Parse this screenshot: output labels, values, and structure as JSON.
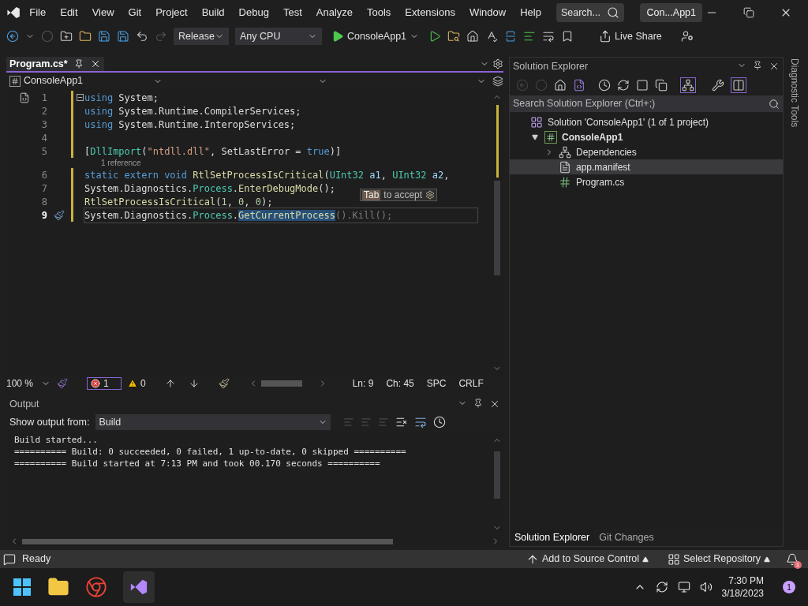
{
  "title_bar": {
    "menu": [
      "File",
      "Edit",
      "View",
      "Git",
      "Project",
      "Build",
      "Debug",
      "Test",
      "Analyze",
      "Tools",
      "Extensions",
      "Window",
      "Help"
    ],
    "search": {
      "placeholder": "Search..."
    },
    "solution_name": "Con...App1"
  },
  "toolbar": {
    "configuration": "Release",
    "platform": "Any CPU",
    "start": "ConsoleApp1",
    "live_share": "Live Share"
  },
  "editor": {
    "tabs": [
      {
        "label": "Program.cs*",
        "selected": true
      }
    ],
    "nav": {
      "project": "ConsoleApp1"
    },
    "lines": [
      {
        "number": "1",
        "current": false,
        "fold": true,
        "tokens": [
          {
            "kind": "kw",
            "text": "using"
          },
          {
            "kind": "plain",
            "text": " System;"
          }
        ]
      },
      {
        "number": "2",
        "current": false,
        "fold": false,
        "tokens": [
          {
            "kind": "kw",
            "text": "using"
          },
          {
            "kind": "plain",
            "text": " System.Runtime.CompilerServices;"
          }
        ]
      },
      {
        "number": "3",
        "current": false,
        "fold": false,
        "tokens": [
          {
            "kind": "kw",
            "text": "using"
          },
          {
            "kind": "plain",
            "text": " System.Runtime.InteropServices;"
          }
        ]
      },
      {
        "number": "4",
        "current": false,
        "fold": false
      },
      {
        "number": "5",
        "current": false,
        "fold": false,
        "tokens": [
          {
            "kind": "plain",
            "text": "["
          },
          {
            "kind": "type",
            "text": "DllImport"
          },
          {
            "kind": "plain",
            "text": "("
          },
          {
            "kind": "str",
            "text": "\"ntdll.dll\""
          },
          {
            "kind": "plain",
            "text": ", SetLastError = "
          },
          {
            "kind": "kw",
            "text": "true"
          },
          {
            "kind": "plain",
            "text": ")]"
          }
        ]
      },
      {
        "number": "6",
        "current": false,
        "fold": false,
        "codelens": "1 reference",
        "tokens": [
          {
            "kind": "kw",
            "text": "static extern void"
          },
          {
            "kind": "method",
            "text": " RtlSetProcessIsCritical"
          },
          {
            "kind": "plain",
            "text": "("
          },
          {
            "kind": "type",
            "text": "UInt32"
          },
          {
            "kind": "param",
            "text": " a1"
          },
          {
            "kind": "plain",
            "text": ", "
          },
          {
            "kind": "type",
            "text": "UInt32"
          },
          {
            "kind": "param",
            "text": " a2"
          },
          {
            "kind": "plain",
            "text": ","
          }
        ]
      },
      {
        "number": "7",
        "current": false,
        "fold": false,
        "tokens": [
          {
            "kind": "plain",
            "text": "System.Diagnostics."
          },
          {
            "kind": "type",
            "text": "Process"
          },
          {
            "kind": "plain",
            "text": "."
          },
          {
            "kind": "method",
            "text": "EnterDebugMode"
          },
          {
            "kind": "plain",
            "text": "();"
          }
        ]
      },
      {
        "number": "8",
        "current": false,
        "fold": false,
        "tokens": [
          {
            "kind": "method",
            "text": "RtlSetProcessIsCritical"
          },
          {
            "kind": "plain",
            "text": "("
          },
          {
            "kind": "num",
            "text": "1"
          },
          {
            "kind": "plain",
            "text": ", "
          },
          {
            "kind": "num",
            "text": "0"
          },
          {
            "kind": "plain",
            "text": ", "
          },
          {
            "kind": "num",
            "text": "0"
          },
          {
            "kind": "plain",
            "text": ");"
          }
        ]
      },
      {
        "number": "9",
        "current": true,
        "fold": false,
        "tokens": [
          {
            "kind": "plain",
            "text": "System.Diagnostics."
          },
          {
            "kind": "type",
            "text": "Process"
          },
          {
            "kind": "plain",
            "text": "."
          },
          {
            "kind": "selection",
            "text": "GetCurrentProcess"
          },
          {
            "kind": "ghost",
            "text": "().Kill();"
          }
        ]
      }
    ],
    "hint": {
      "key": "Tab",
      "text": "to accept"
    },
    "status": {
      "zoom": "100 %",
      "errors": "1",
      "warnings": "0",
      "line": "Ln: 9",
      "column": "Ch: 45",
      "spacing": "SPC",
      "line_ending": "CRLF"
    }
  },
  "output": {
    "title": "Output",
    "source_label": "Show output from:",
    "source": "Build",
    "lines": [
      "Build started...",
      "========== Build: 0 succeeded, 0 failed, 1 up-to-date, 0 skipped ==========",
      "========== Build started at 7:13 PM and took 00.170 seconds =========="
    ]
  },
  "solution_explorer": {
    "title": "Solution Explorer",
    "search": {
      "placeholder": "Search Solution Explorer (Ctrl+;)"
    },
    "tree": [
      {
        "kind": "solution",
        "label": "Solution 'ConsoleApp1' (1 of 1 project)",
        "selected": false,
        "children": [
          {
            "kind": "project",
            "label": "ConsoleApp1",
            "selected": false,
            "expanded": true,
            "children": [
              {
                "kind": "dependencies",
                "label": "Dependencies",
                "selected": false,
                "expanded": false
              },
              {
                "kind": "manifest",
                "label": "app.manifest",
                "selected": true
              },
              {
                "kind": "csharp",
                "label": "Program.cs",
                "selected": false
              }
            ]
          }
        ]
      }
    ],
    "tabs": [
      {
        "label": "Solution Explorer",
        "selected": true
      },
      {
        "label": "Git Changes",
        "selected": false
      }
    ]
  },
  "side_tab": "Diagnostic Tools",
  "status_bar": {
    "text": "Ready",
    "source_control": "Add to Source Control",
    "repository": "Select Repository",
    "notifications": "1"
  },
  "taskbar": {
    "time": "7:30 PM",
    "date": "3/18/2023",
    "badge": "1"
  }
}
